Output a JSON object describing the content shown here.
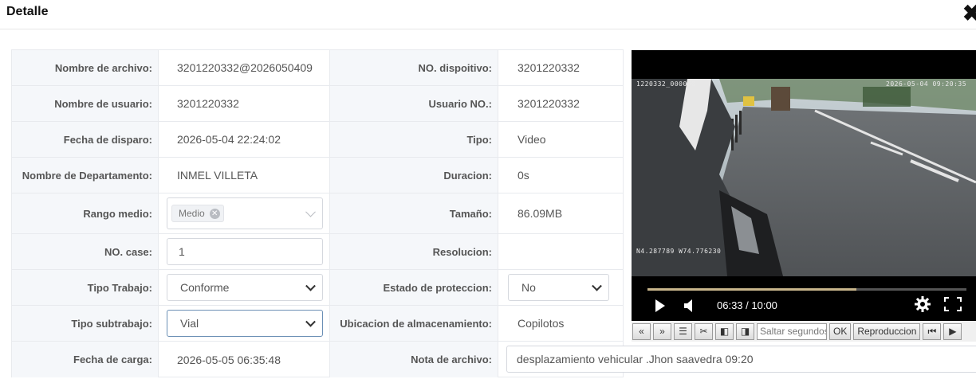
{
  "dialog": {
    "title": "Detalle",
    "close_icon": "close-icon"
  },
  "fields": {
    "nombre_archivo": {
      "label": "Nombre de archivo:",
      "value": "3201220332@2026050409"
    },
    "no_dispositivo": {
      "label": "NO. dispoitivo:",
      "value": "3201220332"
    },
    "nombre_usuario": {
      "label": "Nombre de usuario:",
      "value": "3201220332"
    },
    "usuario_no": {
      "label": "Usuario NO.:",
      "value": "3201220332"
    },
    "fecha_disparo": {
      "label": "Fecha de disparo:",
      "value": "2026-05-04 22:24:02"
    },
    "tipo": {
      "label": "Tipo:",
      "value": "Video"
    },
    "nombre_departamento": {
      "label": "Nombre de Departamento:",
      "value": "INMEL VILLETA"
    },
    "duracion": {
      "label": "Duracion:",
      "value": "0s"
    },
    "rango_medio": {
      "label": "Rango medio:",
      "tag": "Medio"
    },
    "tamano": {
      "label": "Tamaño:",
      "value": "86.09MB"
    },
    "no_case": {
      "label": "NO. case:",
      "value": "1"
    },
    "resolucion": {
      "label": "Resolucion:",
      "value": ""
    },
    "tipo_trabajo": {
      "label": "Tipo Trabajo:",
      "selected": "Conforme"
    },
    "estado_proteccion": {
      "label": "Estado de proteccion:",
      "selected": "No"
    },
    "tipo_subtrabajo": {
      "label": "Tipo subtrabajo:",
      "selected": "Vial"
    },
    "ubicacion": {
      "label": "Ubicacion de almacenamiento:",
      "value": "Copilotos"
    },
    "fecha_carga": {
      "label": "Fecha de carga:",
      "value": "2026-05-05 06:35:48"
    },
    "nota_archivo": {
      "label": "Nota de archivo:",
      "value": "desplazamiento vehicular .Jhon saavedra 09:20"
    }
  },
  "player": {
    "osd_device": "1220332_000000",
    "osd_datetime": "2026-05-04 09:20:35",
    "osd_gps": "N4.287789 W74.776230",
    "time": "06:33 / 10:00",
    "progress_fraction": 0.655,
    "icons": [
      "play-icon",
      "volume-icon",
      "gear-icon",
      "fullscreen-icon"
    ]
  },
  "toolbar": {
    "buttons": [
      "«",
      "»",
      "☰",
      "✂",
      "◧",
      "◨"
    ],
    "seek_placeholder": "Saltar segundos",
    "ok_label": "OK",
    "play_label": "Reproduccion",
    "first_label": "⏮",
    "next_label": "▶"
  }
}
